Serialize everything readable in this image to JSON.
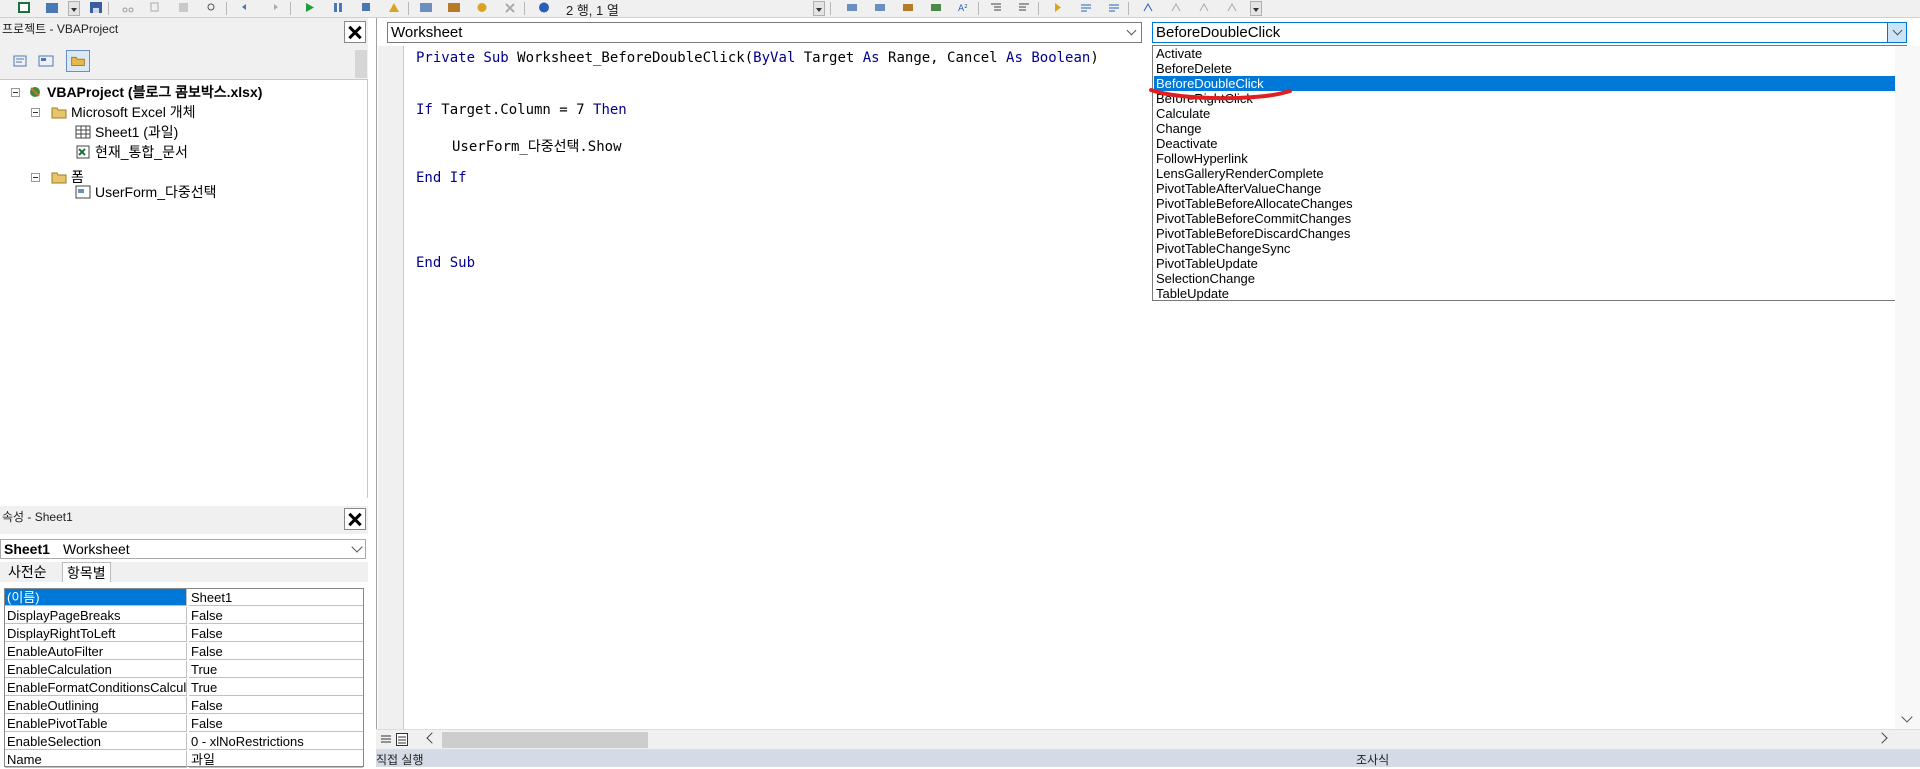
{
  "toolbar": {
    "status": "2 행, 1 열"
  },
  "project": {
    "title": "프로젝트 - VBAProject",
    "tree": {
      "root": "VBAProject (블로그 콤보박스.xlsx)",
      "excel_objects": "Microsoft Excel 개체",
      "sheet1": "Sheet1 (과일)",
      "workbook": "현재_통합_문서",
      "forms": "폼",
      "userform": "UserForm_다중선택"
    }
  },
  "properties": {
    "title": "속성 - Sheet1",
    "object_name": "Sheet1",
    "object_type": "Worksheet",
    "tabs": [
      "사전순",
      "항목별"
    ],
    "rows": [
      {
        "name": "(이름)",
        "value": "Sheet1"
      },
      {
        "name": "DisplayPageBreaks",
        "value": "False"
      },
      {
        "name": "DisplayRightToLeft",
        "value": "False"
      },
      {
        "name": "EnableAutoFilter",
        "value": "False"
      },
      {
        "name": "EnableCalculation",
        "value": "True"
      },
      {
        "name": "EnableFormatConditionsCalculation",
        "value": "True"
      },
      {
        "name": "EnableOutlining",
        "value": "False"
      },
      {
        "name": "EnablePivotTable",
        "value": "False"
      },
      {
        "name": "EnableSelection",
        "value": "0 - xlNoRestrictions"
      },
      {
        "name": "Name",
        "value": "과일"
      }
    ]
  },
  "code": {
    "object_combo": "Worksheet",
    "procedure_combo": "BeforeDoubleClick",
    "line1_kw1": "Private Sub",
    "line1_rest1": " Worksheet_BeforeDoubleClick(",
    "line1_kw2": "ByVal",
    "line1_rest2": " Target ",
    "line1_kw3": "As",
    "line1_rest3": " Range, Cancel ",
    "line1_kw4": "As Boolean",
    "line1_rest4": ")",
    "line2_kw1": "If",
    "line2_rest": " Target.Column = 7 ",
    "line2_kw2": "Then",
    "line3": "UserForm_다중선택.Show",
    "line4": "End If",
    "line5": "End Sub"
  },
  "dropdown_items": [
    "Activate",
    "BeforeDelete",
    "BeforeDoubleClick",
    "BeforeRightClick",
    "Calculate",
    "Change",
    "Deactivate",
    "FollowHyperlink",
    "LensGalleryRenderComplete",
    "PivotTableAfterValueChange",
    "PivotTableBeforeAllocateChanges",
    "PivotTableBeforeCommitChanges",
    "PivotTableBeforeDiscardChanges",
    "PivotTableChangeSync",
    "PivotTableUpdate",
    "SelectionChange",
    "TableUpdate"
  ],
  "dropdown_selected": "BeforeDoubleClick",
  "bottom": {
    "immediate": "직접 실행",
    "watch": "조사식"
  },
  "colors": {
    "keyword": "#00008b",
    "selection": "#0078d7",
    "annotation": "#e21f1f"
  }
}
